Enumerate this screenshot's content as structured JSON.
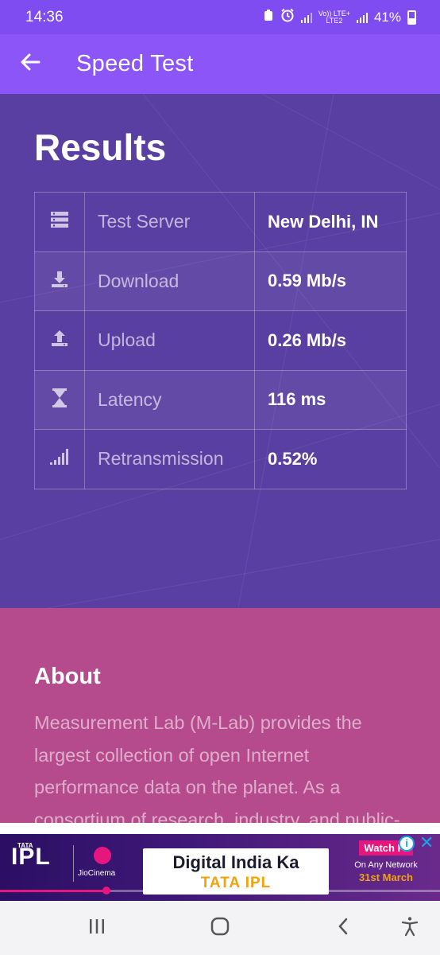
{
  "status_bar": {
    "time": "14:36",
    "network_top": "Vo)) LTE+",
    "network_bottom": "LTE2",
    "battery": "41%"
  },
  "app_bar": {
    "title": "Speed Test",
    "back_icon": "arrow-left-icon"
  },
  "results": {
    "heading": "Results",
    "rows": [
      {
        "icon": "server-icon",
        "label": "Test Server",
        "value": "New Delhi, IN"
      },
      {
        "icon": "download-icon",
        "label": "Download",
        "value": "0.59 Mb/s"
      },
      {
        "icon": "upload-icon",
        "label": "Upload",
        "value": "0.26 Mb/s"
      },
      {
        "icon": "hourglass-icon",
        "label": "Latency",
        "value": "116 ms"
      },
      {
        "icon": "signal-bars-icon",
        "label": "Retransmission",
        "value": "0.52%"
      }
    ]
  },
  "about": {
    "heading": "About",
    "text": "Measurement Lab (M-Lab) provides the largest collection of open Internet performance data on the planet. As a consortium of research, industry, and public-"
  },
  "ad": {
    "ipl_brand": "IPL",
    "tata_text": "TATA",
    "jio_label": "JioCinema",
    "headline_1": "Digital India Ka",
    "headline_2": "TATA IPL",
    "watch_free": "Watch Fr",
    "sub_1": "On Any Network",
    "sub_2": "31st March",
    "info_symbol": "i",
    "close_symbol": "✕"
  },
  "colors": {
    "status_bar": "#7f4cf2",
    "app_bar": "#8b55f7",
    "results_bg": "#5a3fa2",
    "about_bg": "#b54b8d"
  }
}
